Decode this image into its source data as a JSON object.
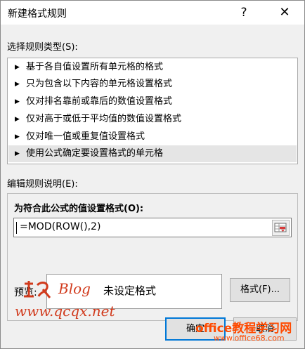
{
  "window": {
    "title": "新建格式规则",
    "help_glyph": "?",
    "close_glyph": "✕"
  },
  "rule_type_label": "选择规则类型(S):",
  "rule_types": [
    {
      "label": "基于各自值设置所有单元格的格式"
    },
    {
      "label": "只为包含以下内容的单元格设置格式"
    },
    {
      "label": "仅对排名靠前或靠后的数值设置格式"
    },
    {
      "label": "仅对高于或低于平均值的数值设置格式"
    },
    {
      "label": "仅对唯一值或重复值设置格式"
    },
    {
      "label": "使用公式确定要设置格式的单元格",
      "selected": true
    }
  ],
  "arrow_glyph": "▶",
  "edit_label": "编辑规则说明(E):",
  "formula_label": "为符合此公式的值设置格式(O):",
  "formula_value": "=MOD(ROW(),2)",
  "preview_label": "预览:",
  "preview_text": "未设定格式",
  "format_button": "格式(F)...",
  "ok_button": "确定",
  "cancel_button": "取消",
  "watermarks": {
    "blog": "Blog",
    "url": "www.qcqx.net",
    "site_main": "office教程学习网",
    "site_url": "www.office68.com"
  }
}
